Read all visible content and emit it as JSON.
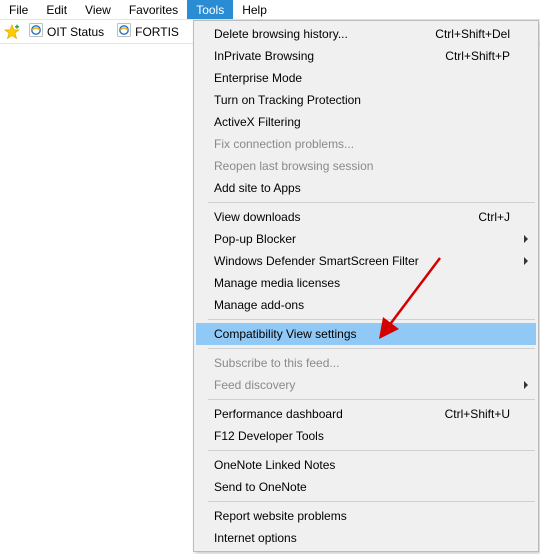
{
  "menubar": {
    "items": [
      {
        "label": "File"
      },
      {
        "label": "Edit"
      },
      {
        "label": "View"
      },
      {
        "label": "Favorites"
      },
      {
        "label": "Tools",
        "active": true
      },
      {
        "label": "Help"
      }
    ]
  },
  "favorites_bar": {
    "items": [
      {
        "label": "OIT Status"
      },
      {
        "label": "FORTIS"
      }
    ]
  },
  "dropdown": {
    "groups": [
      [
        {
          "label": "Delete browsing history...",
          "accel": "Ctrl+Shift+Del"
        },
        {
          "label": "InPrivate Browsing",
          "accel": "Ctrl+Shift+P"
        },
        {
          "label": "Enterprise Mode"
        },
        {
          "label": "Turn on Tracking Protection"
        },
        {
          "label": "ActiveX Filtering"
        },
        {
          "label": "Fix connection problems...",
          "disabled": true
        },
        {
          "label": "Reopen last browsing session",
          "disabled": true
        },
        {
          "label": "Add site to Apps"
        }
      ],
      [
        {
          "label": "View downloads",
          "accel": "Ctrl+J"
        },
        {
          "label": "Pop-up Blocker",
          "submenu": true
        },
        {
          "label": "Windows Defender SmartScreen Filter",
          "submenu": true
        },
        {
          "label": "Manage media licenses"
        },
        {
          "label": "Manage add-ons"
        }
      ],
      [
        {
          "label": "Compatibility View settings",
          "highlight": true
        }
      ],
      [
        {
          "label": "Subscribe to this feed...",
          "disabled": true
        },
        {
          "label": "Feed discovery",
          "disabled": true,
          "submenu": true
        }
      ],
      [
        {
          "label": "Performance dashboard",
          "accel": "Ctrl+Shift+U"
        },
        {
          "label": "F12 Developer Tools"
        }
      ],
      [
        {
          "label": "OneNote Linked Notes"
        },
        {
          "label": "Send to OneNote"
        }
      ],
      [
        {
          "label": "Report website problems"
        },
        {
          "label": "Internet options"
        }
      ]
    ]
  }
}
